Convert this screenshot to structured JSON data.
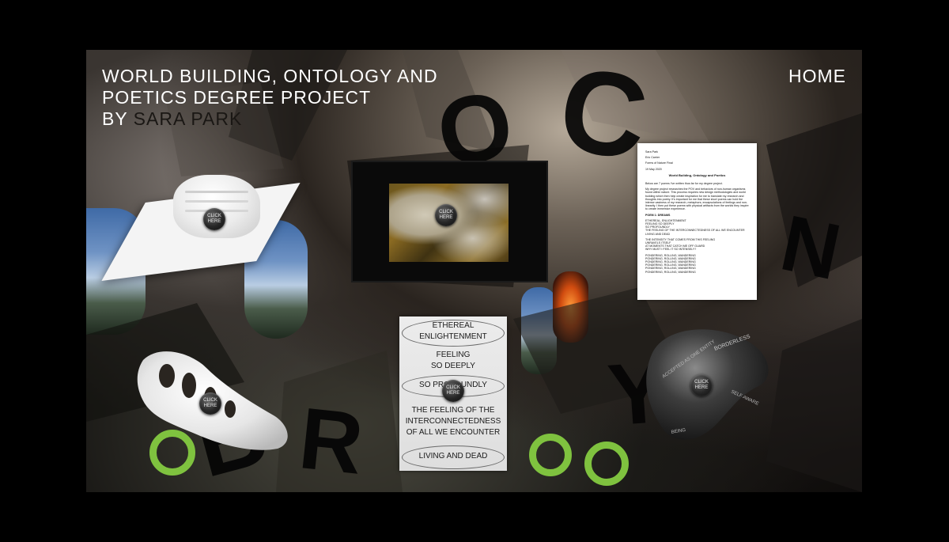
{
  "header": {
    "title_line1": "WORLD BUILDING, ONTOLOGY AND",
    "title_line2": "POETICS DEGREE PROJECT",
    "title_by": "BY",
    "author": "SARA PARK",
    "home_label": "HOME"
  },
  "click_label_1": "CLICK",
  "click_label_2": "HERE",
  "poem_card": {
    "lines": [
      "ETHEREAL",
      "ENLIGHTENMENT",
      "FEELING",
      "SO DEEPLY",
      "SO PROFOUNDLY",
      "THE FEELING OF THE",
      "INTERCONNECTEDNESS",
      "OF ALL WE ENCOUNTER",
      "LIVING AND DEAD"
    ]
  },
  "stone_engraving": {
    "text_a": "BORDERLESS",
    "text_b": "ACCEPTED AS ONE ENTITY",
    "text_c": "SELF AWARE",
    "text_d": "BEING"
  },
  "document": {
    "author": "Sara Park",
    "teacher": "Eric Carrier",
    "course": "Forms of Nature Final",
    "date": "19 May 2020",
    "heading": "World Building, Ontology and Poetics",
    "intro": "Below are 7 poems I've written thus far for my degree project.",
    "body": "My degree project researches the POV and behaviors of non-human organisms found within nature. This process requires new design methodologies and world building which then help create inspiration for me to translate my research and thoughts into poetry. It's important for me that these short poems can hold the intense vastness of my research, metaphors, encapsulations of feelings and non-linearity. I then put these poems with physical artifacts from the worlds they inspire to create immersive experience.",
    "poem_title": "POEM 1: DREAMS",
    "poem_lines": [
      "ETHEREAL, ENLIGHTENMENT",
      "FEELING SO DEEPLY",
      "SO PROFOUNDLY",
      "THE FEELING OF THE INTERCONNECTEDNESS OF ALL WE ENCOUNTER",
      "LIVING AND DEAD"
    ],
    "poem_lines_2": [
      "THE INTENSITY THAT COMES FROM THIS FEELING",
      "UNRAVELS ITSELF",
      "AT MOMENTS THAT CATCH ME OFF GUARD",
      "WHY MUST I FEEL IT SO INTENSELY?"
    ],
    "poem_lines_3": [
      "PONDERING, ROLLING, WANDERING",
      "PONDERING, ROLLING, WANDERING",
      "PONDERING, ROLLING, WANDERING",
      "PONDERING, ROLLING, WANDERING",
      "PONDERING, ROLLING, WANDERING",
      "PONDERING, ROLLING, WANDERING"
    ]
  },
  "colors": {
    "background": "#000000",
    "title_text": "#ffffff",
    "author_text": "#1a1714",
    "paper": "#ffffff",
    "poem_card": "#e6e6e6",
    "accent_green": "#7fc23f"
  },
  "icons": {
    "click_button": "round-black-button-icon"
  }
}
